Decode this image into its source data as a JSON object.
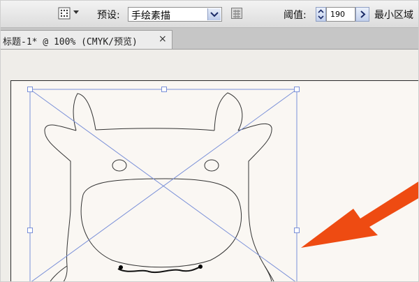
{
  "control_bar": {
    "tool_icon": "halftone-grid-icon",
    "preset_label": "预设:",
    "preset_value": "手绘素描",
    "preset_arrow_icon": "chevron-down-icon",
    "options_icon": "preset-options-icon",
    "threshold_label": "阈值:",
    "threshold_value": "190",
    "threshold_spinner_icon": "spinner-updown-icon",
    "threshold_arrow_icon": "chevron-right-icon",
    "min_area_label": "最小区域"
  },
  "document_tab": {
    "title": "标题-1* @ 100% (CMYK/预览)",
    "close_glyph": "×"
  },
  "canvas": {
    "selection_color": "#7a90d8",
    "outline_color": "#333333",
    "arrow_color": "#ee4b12",
    "artboard_color": "#faf7f3",
    "pointer": "orange-arrow-icon"
  }
}
